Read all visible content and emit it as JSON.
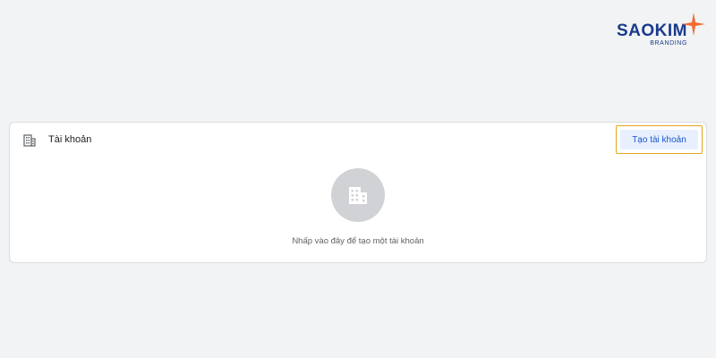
{
  "logo": {
    "word": "SAOKIM",
    "sub": "BRANDING",
    "brand_color": "#1a3a8c",
    "star_color": "#f26a2e"
  },
  "card": {
    "icon": "building-icon",
    "title": "Tài khoản",
    "create_label": "Tạo tài khoản",
    "empty_icon": "building-icon",
    "empty_text": "Nhấp vào đây để tạo một tài khoản"
  },
  "colors": {
    "background": "#f1f3f4",
    "button_bg": "#e8f0fe",
    "button_text": "#1a56c8",
    "focus_outline": "#e2a61c"
  }
}
